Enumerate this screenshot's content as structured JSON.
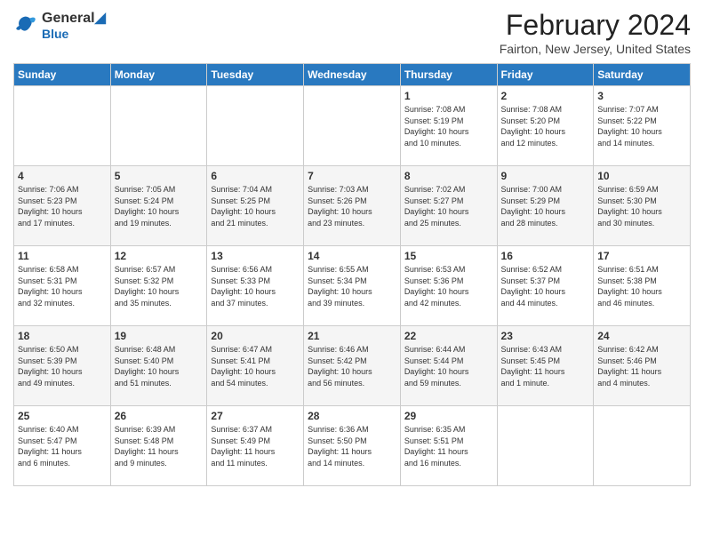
{
  "header": {
    "logo_line1": "General",
    "logo_line2": "Blue",
    "month_year": "February 2024",
    "location": "Fairton, New Jersey, United States"
  },
  "days_of_week": [
    "Sunday",
    "Monday",
    "Tuesday",
    "Wednesday",
    "Thursday",
    "Friday",
    "Saturday"
  ],
  "weeks": [
    [
      {
        "day": "",
        "info": ""
      },
      {
        "day": "",
        "info": ""
      },
      {
        "day": "",
        "info": ""
      },
      {
        "day": "",
        "info": ""
      },
      {
        "day": "1",
        "info": "Sunrise: 7:08 AM\nSunset: 5:19 PM\nDaylight: 10 hours\nand 10 minutes."
      },
      {
        "day": "2",
        "info": "Sunrise: 7:08 AM\nSunset: 5:20 PM\nDaylight: 10 hours\nand 12 minutes."
      },
      {
        "day": "3",
        "info": "Sunrise: 7:07 AM\nSunset: 5:22 PM\nDaylight: 10 hours\nand 14 minutes."
      }
    ],
    [
      {
        "day": "4",
        "info": "Sunrise: 7:06 AM\nSunset: 5:23 PM\nDaylight: 10 hours\nand 17 minutes."
      },
      {
        "day": "5",
        "info": "Sunrise: 7:05 AM\nSunset: 5:24 PM\nDaylight: 10 hours\nand 19 minutes."
      },
      {
        "day": "6",
        "info": "Sunrise: 7:04 AM\nSunset: 5:25 PM\nDaylight: 10 hours\nand 21 minutes."
      },
      {
        "day": "7",
        "info": "Sunrise: 7:03 AM\nSunset: 5:26 PM\nDaylight: 10 hours\nand 23 minutes."
      },
      {
        "day": "8",
        "info": "Sunrise: 7:02 AM\nSunset: 5:27 PM\nDaylight: 10 hours\nand 25 minutes."
      },
      {
        "day": "9",
        "info": "Sunrise: 7:00 AM\nSunset: 5:29 PM\nDaylight: 10 hours\nand 28 minutes."
      },
      {
        "day": "10",
        "info": "Sunrise: 6:59 AM\nSunset: 5:30 PM\nDaylight: 10 hours\nand 30 minutes."
      }
    ],
    [
      {
        "day": "11",
        "info": "Sunrise: 6:58 AM\nSunset: 5:31 PM\nDaylight: 10 hours\nand 32 minutes."
      },
      {
        "day": "12",
        "info": "Sunrise: 6:57 AM\nSunset: 5:32 PM\nDaylight: 10 hours\nand 35 minutes."
      },
      {
        "day": "13",
        "info": "Sunrise: 6:56 AM\nSunset: 5:33 PM\nDaylight: 10 hours\nand 37 minutes."
      },
      {
        "day": "14",
        "info": "Sunrise: 6:55 AM\nSunset: 5:34 PM\nDaylight: 10 hours\nand 39 minutes."
      },
      {
        "day": "15",
        "info": "Sunrise: 6:53 AM\nSunset: 5:36 PM\nDaylight: 10 hours\nand 42 minutes."
      },
      {
        "day": "16",
        "info": "Sunrise: 6:52 AM\nSunset: 5:37 PM\nDaylight: 10 hours\nand 44 minutes."
      },
      {
        "day": "17",
        "info": "Sunrise: 6:51 AM\nSunset: 5:38 PM\nDaylight: 10 hours\nand 46 minutes."
      }
    ],
    [
      {
        "day": "18",
        "info": "Sunrise: 6:50 AM\nSunset: 5:39 PM\nDaylight: 10 hours\nand 49 minutes."
      },
      {
        "day": "19",
        "info": "Sunrise: 6:48 AM\nSunset: 5:40 PM\nDaylight: 10 hours\nand 51 minutes."
      },
      {
        "day": "20",
        "info": "Sunrise: 6:47 AM\nSunset: 5:41 PM\nDaylight: 10 hours\nand 54 minutes."
      },
      {
        "day": "21",
        "info": "Sunrise: 6:46 AM\nSunset: 5:42 PM\nDaylight: 10 hours\nand 56 minutes."
      },
      {
        "day": "22",
        "info": "Sunrise: 6:44 AM\nSunset: 5:44 PM\nDaylight: 10 hours\nand 59 minutes."
      },
      {
        "day": "23",
        "info": "Sunrise: 6:43 AM\nSunset: 5:45 PM\nDaylight: 11 hours\nand 1 minute."
      },
      {
        "day": "24",
        "info": "Sunrise: 6:42 AM\nSunset: 5:46 PM\nDaylight: 11 hours\nand 4 minutes."
      }
    ],
    [
      {
        "day": "25",
        "info": "Sunrise: 6:40 AM\nSunset: 5:47 PM\nDaylight: 11 hours\nand 6 minutes."
      },
      {
        "day": "26",
        "info": "Sunrise: 6:39 AM\nSunset: 5:48 PM\nDaylight: 11 hours\nand 9 minutes."
      },
      {
        "day": "27",
        "info": "Sunrise: 6:37 AM\nSunset: 5:49 PM\nDaylight: 11 hours\nand 11 minutes."
      },
      {
        "day": "28",
        "info": "Sunrise: 6:36 AM\nSunset: 5:50 PM\nDaylight: 11 hours\nand 14 minutes."
      },
      {
        "day": "29",
        "info": "Sunrise: 6:35 AM\nSunset: 5:51 PM\nDaylight: 11 hours\nand 16 minutes."
      },
      {
        "day": "",
        "info": ""
      },
      {
        "day": "",
        "info": ""
      }
    ]
  ]
}
